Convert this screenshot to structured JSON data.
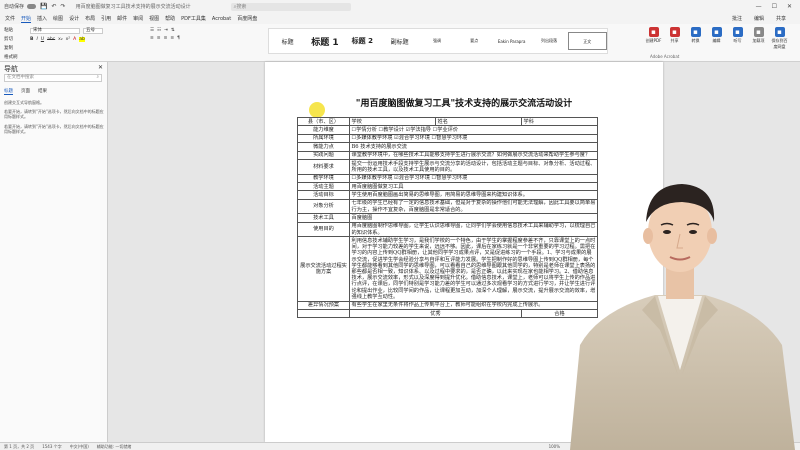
{
  "titlebar": {
    "autosave": "自动保存",
    "doc_title": "用百度脑图做复习工具技术支持的展示交流活动设计",
    "search_placeholder": "搜索"
  },
  "menu": [
    "文件",
    "开始",
    "插入",
    "绘图",
    "设计",
    "布局",
    "引用",
    "邮件",
    "审阅",
    "视图",
    "帮助",
    "PDF工具集",
    "Acrobat",
    "百度网盘"
  ],
  "menu_right": [
    "批注",
    "编辑",
    "共享"
  ],
  "ribbon": {
    "clipboard": [
      "粘贴",
      "剪切",
      "复制",
      "格式刷"
    ],
    "font_name": "宋体",
    "font_size": "五号",
    "font_buttons": [
      "B",
      "I",
      "U",
      "abc",
      "x₂",
      "x²"
    ],
    "paragraph_buttons": [
      "≡",
      "≡",
      "≡",
      "≡",
      "¶"
    ],
    "styles": [
      {
        "label": "标题",
        "cls": ""
      },
      {
        "label": "标题 1",
        "cls": "h1"
      },
      {
        "label": "标题 2",
        "cls": "h2"
      },
      {
        "label": "副标题",
        "cls": ""
      },
      {
        "label": "强调",
        "cls": "small"
      },
      {
        "label": "要点",
        "cls": "small"
      },
      {
        "label": "Eakin Parapra",
        "cls": "small"
      },
      {
        "label": "列出段落",
        "cls": "small"
      },
      {
        "label": "正文",
        "cls": "small sel"
      }
    ],
    "right_buttons": [
      {
        "label": "创建PDF",
        "color": "red"
      },
      {
        "label": "共享",
        "color": "red"
      },
      {
        "label": "转换",
        "color": "blue"
      },
      {
        "label": "编辑",
        "color": "blue"
      },
      {
        "label": "听写",
        "color": "blue"
      },
      {
        "label": "加载项",
        "color": "gray"
      },
      {
        "label": "保存到百度网盘",
        "color": "blue"
      }
    ],
    "acrobat_label": "Adobe Acrobat"
  },
  "nav": {
    "title": "导航",
    "search_placeholder": "在文档中搜索",
    "tabs": [
      "标题",
      "页面",
      "结果"
    ],
    "messages": [
      "创建交互式导航窗格。",
      "若要开始，请转到\"开始\"选项卡，然后向文档中的标题应用标题样式。",
      "若要开始，请转到\"开始\"选项卡，然后向文档中的标题应用标题样式。"
    ]
  },
  "document": {
    "title": "\"用百度脑图做复习工具\"技术支持的展示交流活动设计",
    "table": [
      [
        {
          "t": "县（市、区）",
          "cls": "label"
        },
        {
          "t": "学校",
          "colspan": 1
        },
        {
          "t": "姓名"
        },
        {
          "t": "学科"
        }
      ],
      [
        {
          "t": "能力维度",
          "cls": "label"
        },
        {
          "t": "☐学情分析 ☐教学设计 ☑学法指导 ☐学业评价",
          "colspan": 3
        }
      ],
      [
        {
          "t": "所属环境",
          "cls": "label"
        },
        {
          "t": "☐多媒体教学环境 ☑混合学习环境 ☐智慧学习环境",
          "colspan": 3
        }
      ],
      [
        {
          "t": "微能力点",
          "cls": "label"
        },
        {
          "t": "B6 技术支持的展示交流",
          "colspan": 3
        }
      ],
      [
        {
          "t": "实践问题",
          "cls": "label"
        },
        {
          "t": "课堂教学环境中，在哪些技术工具能够支持学生进行展示交流？如何做展示交流活动来帮助学生参与度？",
          "colspan": 3
        }
      ],
      [
        {
          "t": "材料要求",
          "cls": "label"
        },
        {
          "t": "提交一份运用技术手段支持学生展示与交流分享的活动设计，包括活动主题与目标、对象分析、活动过程、所用的技术工具，以及技术工具使用的目的。",
          "colspan": 3
        }
      ],
      [
        {
          "t": "教学环境",
          "cls": "label"
        },
        {
          "t": "☐多媒体教学环境 ☑混合学习环境 ☐智慧学习环境",
          "colspan": 3
        }
      ],
      [
        {
          "t": "活动主题",
          "cls": "label"
        },
        {
          "t": "用百度脑图做复习工具",
          "colspan": 3
        }
      ],
      [
        {
          "t": "活动目标",
          "cls": "label"
        },
        {
          "t": "学生使用百度脑图画出简易的思维导图，用简易的思维导图来构建知识体系。",
          "colspan": 3
        }
      ],
      [
        {
          "t": "对象分析",
          "cls": "label"
        },
        {
          "t": "七年级的学生已经有了一定的信息技术基础，但是对于复杂的操作他们可能无法理解，因此工具要以简单易行为主，操作不宜复杂，百度脑图是非常适合的。",
          "colspan": 3
        }
      ],
      [
        {
          "t": "技术工具",
          "cls": "label"
        },
        {
          "t": "百度脑图",
          "colspan": 3
        }
      ],
      [
        {
          "t": "使用目的",
          "cls": "label"
        },
        {
          "t": "用百度脑图制作思维导图，让学生认识思维导图，让同学们学会使用信息技术工具来辅助学习，以梳理自己的知识体系。",
          "colspan": 3
        }
      ],
      [
        {
          "t": "展示交流活动过程实施方案",
          "cls": "label"
        },
        {
          "t": "利用信息技术辅助学生学习，是我们学校的一个特色，由于学生的掌握程度参差不齐，只靠课堂上的一点时间，对于学习能力较差的学生来说，远远不够。因此，课后在家练习就是一个非常重要的学习过程。需把在学习的内容上传到QQ群相册，让其他同学学习成果点评，又是促进练习的一个手段。1、学习与成果的展示交流，促进学生学会经验分享与自评和互评能力发展。学生把制作好的思维导图上传到QQ群相册，每个学生都能够看到其他同学的思维导图，可以看看自己的思维导图跟其他同学的，特别是老师在课堂上表扬的那些都是否相一致，知识体系、以及过程中要求的，是否正确，以此来实现在家也能相学习。2、借助信息技术，展示交流效率，形式以及深度得到提升优化。借助信息技术，课堂上，老师可以将学生上传的作品进行点评，在课后，同学们特别是学习能力差的学生可以通过多次观看学习的方式进行学习，并让学生进行评论和提出作业，比较同学间的作品，让课程更加互动，加深个人理解，展示交流，提升展示交流的效率，增强线上教学互动性。",
          "colspan": 3
        }
      ],
      [
        {
          "t": "差异情况预案",
          "cls": "label"
        },
        {
          "t": "有些学生在家里无条件将作品上传到平台上，教师可能组织在学校内完成上传展示。",
          "colspan": 3
        }
      ],
      [
        {
          "t": "",
          "cls": "label"
        },
        {
          "t": "优秀",
          "colspan": 2
        },
        {
          "t": "合格"
        }
      ]
    ]
  },
  "status": {
    "page": "第 1 页，共 2 页",
    "words": "1543 个字",
    "lang": "中文(中国)",
    "accessibility": "辅助功能: 一切就绪",
    "zoom": "100%"
  }
}
